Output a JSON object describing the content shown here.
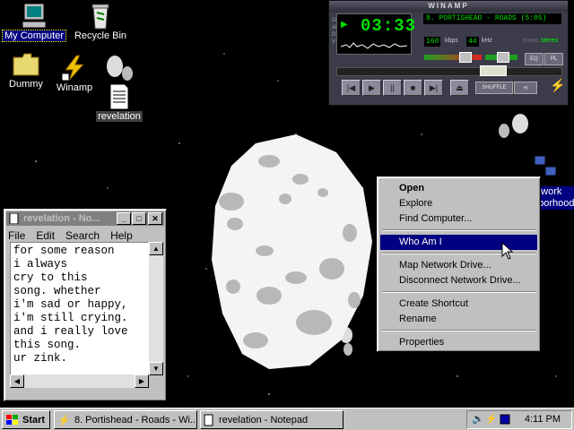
{
  "desktop": {
    "icons": [
      {
        "label": "My Computer"
      },
      {
        "label": "Recycle Bin"
      },
      {
        "label": "Dummy"
      },
      {
        "label": "Winamp"
      },
      {
        "label": "revelation"
      },
      {
        "label": "Network Neighborhood",
        "partial": "etwork\nhborhood"
      }
    ]
  },
  "notepad": {
    "title": "revelation - No...",
    "menu": [
      "File",
      "Edit",
      "Search",
      "Help"
    ],
    "text": "for some reason\ni always\ncry to this\nsong. whether\ni'm sad or happy,\ni'm still crying.\nand i really love\nthis song.\nur zink."
  },
  "context_menu": {
    "items": [
      {
        "label": "Open",
        "bold": true
      },
      {
        "label": "Explore"
      },
      {
        "label": "Find Computer..."
      },
      {
        "label": "Who Am I",
        "highlighted": true
      },
      {
        "label": "Map Network Drive..."
      },
      {
        "label": "Disconnect Network Drive..."
      },
      {
        "label": "Create Shortcut"
      },
      {
        "label": "Rename"
      },
      {
        "label": "Properties"
      }
    ]
  },
  "winamp": {
    "title": "WINAMP",
    "time": "03:33",
    "song": "8. PORTISHEAD - ROADS (5:05)",
    "kbps": "160",
    "kbps_label": "kbps",
    "khz": "44",
    "khz_label": "kHz",
    "mono_label": "mono",
    "stereo_label": "stereo",
    "shuffle_label": "SHUFFLE",
    "eq_label": "EQ",
    "pl_label": "PL",
    "side_letters": "OAIDV"
  },
  "taskbar": {
    "start_label": "Start",
    "tasks": [
      {
        "label": "8. Portishead - Roads - Wi..."
      },
      {
        "label": "revelation - Notepad"
      }
    ],
    "clock": "4:11 PM"
  },
  "colors": {
    "highlight": "#000080",
    "face": "#c0c0c0",
    "lcd_green": "#00e000"
  }
}
